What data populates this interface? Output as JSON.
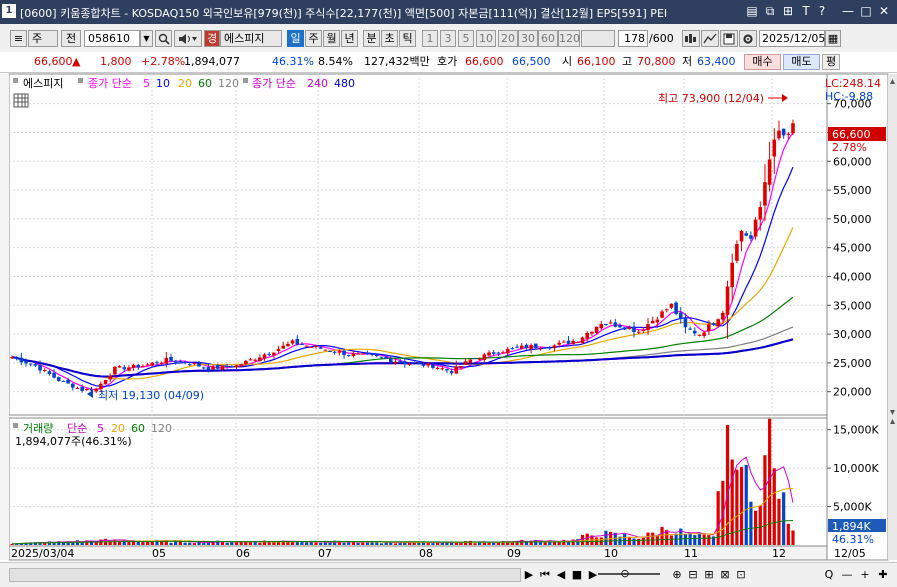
{
  "window": {
    "number": "1",
    "title": "[0600] 키움종합차트 - KOSDAQ150 외국인보유[979(천)] 주식수[22,177(천)] 액면[500] 자본금[111(억)] 결산[12월] EPS[591] PEI",
    "buttons": [
      "▤",
      "⧉",
      "⊞",
      "T",
      "?",
      "—",
      "□",
      "✕"
    ]
  },
  "toolbar": {
    "list_icon": "≡",
    "market": "주",
    "prev": "전",
    "code": "058610",
    "dropdown": "▼",
    "search_icon": "🔍",
    "sound_icon": "◀",
    "tag": "경",
    "stock_name": "에스피지",
    "periods": [
      "일",
      "주",
      "월",
      "년",
      "분",
      "초",
      "틱"
    ],
    "active_period": "일",
    "intervals": [
      "1",
      "3",
      "5",
      "10",
      "20",
      "30",
      "60",
      "120"
    ],
    "count": "178",
    "count_total": "/600",
    "date": "2025/12/05",
    "calendar_icon": "▦"
  },
  "quote": {
    "price": "66,600",
    "arrow": "▲",
    "change": "1,800",
    "change_pct": "+2.78%",
    "volume": "1,894,077",
    "volume_ratio": "46.31%",
    "turnover": "8.54%",
    "amount": "127,432백만",
    "ask_label": "호가",
    "ask": "66,600",
    "bid": "66,500",
    "open_label": "시",
    "open": "66,100",
    "high_label": "고",
    "high": "70,800",
    "low_label": "저",
    "low": "63,400",
    "buy": "매수",
    "sell": "매도",
    "flat": "평"
  },
  "price_legend": {
    "name": "에스피지",
    "ma_label": "종가 단순",
    "ma_periods": [
      "5",
      "10",
      "20",
      "60",
      "120"
    ],
    "ma_colors": [
      "#ff00ff",
      "#0000ff",
      "#e6a800",
      "#008000",
      "#808080"
    ],
    "ma2_label": "종가 단순",
    "ma2_periods": [
      "240",
      "480"
    ],
    "ma2_colors": [
      "#cc00cc",
      "#0000cc"
    ],
    "lc": "LC:248.14",
    "hc": "HC:-9.88"
  },
  "volume_legend": {
    "label": "거래량",
    "ma_label": "단순",
    "ma_periods": [
      "5",
      "20",
      "60",
      "120"
    ],
    "ma_colors": [
      "#cc00cc",
      "#e6a800",
      "#008000",
      "#808080"
    ],
    "value_line": "1,894,077주(46.31%)"
  },
  "annotations": {
    "high": "최고 73,900 (12/04)",
    "low": "최저 19,130 (04/09)",
    "last_price": "66,600",
    "last_pct": "2.78%",
    "last_volume": "1,894K",
    "last_vol_pct": "46.31%"
  },
  "chart_data": [
    {
      "type": "candlestick",
      "title": "에스피지",
      "y_ticks": [
        20000,
        25000,
        30000,
        35000,
        40000,
        45000,
        50000,
        55000,
        60000,
        65000,
        70000
      ],
      "y_tick_labels": [
        "20,000",
        "25,000",
        "30,000",
        "35,000",
        "40,000",
        "45,000",
        "50,000",
        "55,000",
        "60,000",
        "65,000",
        "70,000"
      ],
      "ylim": [
        16300,
        74800
      ],
      "x_labels": [
        "2025/03/04",
        "05",
        "06",
        "07",
        "08",
        "09",
        "10",
        "11",
        "12"
      ],
      "x_right_label": "12/05",
      "high": {
        "value": 73900,
        "date": "12/04"
      },
      "low": {
        "value": 19130,
        "date": "04/09"
      },
      "close_anchors": [
        [
          0,
          26000
        ],
        [
          5,
          24500
        ],
        [
          10,
          22000
        ],
        [
          15,
          20300
        ],
        [
          18,
          20500
        ],
        [
          22,
          24000
        ],
        [
          28,
          24500
        ],
        [
          33,
          25500
        ],
        [
          38,
          25000
        ],
        [
          42,
          24000
        ],
        [
          48,
          24500
        ],
        [
          54,
          26500
        ],
        [
          60,
          28500
        ],
        [
          66,
          27500
        ],
        [
          72,
          26500
        ],
        [
          78,
          26000
        ],
        [
          84,
          25000
        ],
        [
          90,
          24500
        ],
        [
          94,
          23500
        ],
        [
          98,
          25500
        ],
        [
          104,
          27000
        ],
        [
          110,
          27800
        ],
        [
          116,
          28000
        ],
        [
          121,
          29000
        ],
        [
          126,
          32000
        ],
        [
          130,
          31500
        ],
        [
          134,
          30500
        ],
        [
          138,
          33000
        ],
        [
          141,
          35000
        ],
        [
          144,
          31000
        ],
        [
          147,
          30000
        ],
        [
          150,
          32000
        ],
        [
          152,
          34000
        ],
        [
          154,
          43000
        ],
        [
          156,
          48000
        ],
        [
          158,
          46500
        ],
        [
          160,
          52000
        ],
        [
          162,
          61000
        ],
        [
          164,
          65000
        ],
        [
          166,
          64000
        ],
        [
          167,
          66600
        ]
      ],
      "ma_lines": [
        {
          "period": 5,
          "color": "#ff00ff"
        },
        {
          "period": 10,
          "color": "#0000ff"
        },
        {
          "period": 20,
          "color": "#e6a800"
        },
        {
          "period": 60,
          "color": "#008000"
        },
        {
          "period": 120,
          "color": "#808080"
        },
        {
          "period": 240,
          "color": "#cc00cc"
        },
        {
          "period": 480,
          "color": "#0000cc"
        }
      ]
    },
    {
      "type": "bar",
      "title": "거래량",
      "y_ticks": [
        5000,
        10000,
        15000
      ],
      "y_tick_labels": [
        "5,000K",
        "10,000K",
        "15,000K"
      ],
      "ylim": [
        0,
        16000
      ],
      "units": "K",
      "volume_anchors": [
        [
          0,
          200
        ],
        [
          20,
          600
        ],
        [
          40,
          400
        ],
        [
          60,
          500
        ],
        [
          80,
          300
        ],
        [
          100,
          400
        ],
        [
          110,
          500
        ],
        [
          120,
          600
        ],
        [
          125,
          1500
        ],
        [
          130,
          1200
        ],
        [
          135,
          1000
        ],
        [
          140,
          2200
        ],
        [
          145,
          1300
        ],
        [
          150,
          900
        ],
        [
          153,
          15500
        ],
        [
          154,
          8000
        ],
        [
          155,
          16000
        ],
        [
          156,
          10500
        ],
        [
          158,
          5000
        ],
        [
          160,
          8500
        ],
        [
          162,
          13500
        ],
        [
          163,
          9000
        ],
        [
          164,
          8000
        ],
        [
          165,
          5000
        ],
        [
          166,
          3500
        ],
        [
          167,
          1894
        ]
      ]
    }
  ],
  "bottom": {
    "buttons": [
      "▶",
      "⏮",
      "◀",
      "■",
      "▶"
    ],
    "zoom_label": "⊙",
    "tool_icons": [
      "⊕",
      "⊟",
      "⊞",
      "⊠",
      "⊡",
      "Q",
      "—",
      "+",
      "✚"
    ]
  }
}
